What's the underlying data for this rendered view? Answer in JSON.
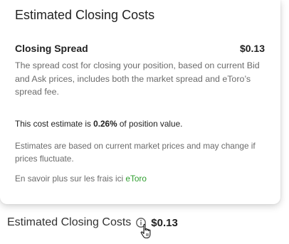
{
  "popover": {
    "title": "Estimated Closing Costs",
    "spread_label": "Closing Spread",
    "spread_value": "$0.13",
    "spread_description": "The spread cost for closing your position, based on current Bid and Ask prices, includes both the market spread and eToro’s spread fee.",
    "estimate_prefix": "This cost estimate is ",
    "estimate_percent": "0.26%",
    "estimate_suffix": " of position value.",
    "disclaimer": "Estimates are based on current market prices and may change if prices fluctuate.",
    "more_info_prefix": "En savoir plus sur les frais ici ",
    "more_info_link": "eToro",
    "link_color": "#2e9e2e"
  },
  "footer": {
    "label": "Estimated Closing Costs",
    "value": "$0.13",
    "info_icon": "info-icon"
  },
  "cursor": {
    "icon": "hand-pointer-cursor"
  }
}
